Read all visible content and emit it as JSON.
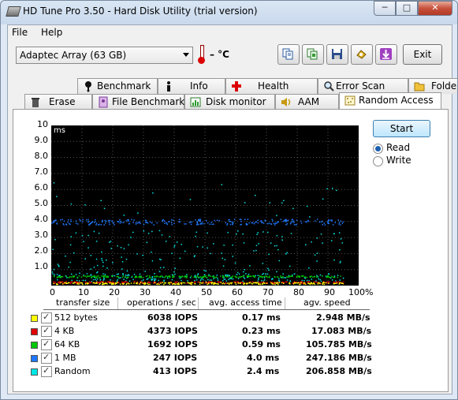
{
  "window": {
    "title": "HD Tune Pro 3.50 - Hard Disk Utility (trial version)"
  },
  "menu": {
    "file": "File",
    "help": "Help"
  },
  "toolbar": {
    "drive": "Adaptec Array (63 GB)",
    "temperature": "– °C",
    "exit": "Exit"
  },
  "tabs_top": [
    {
      "label": "Benchmark",
      "icon": "benchmark-icon"
    },
    {
      "label": "Info",
      "icon": "info-icon"
    },
    {
      "label": "Health",
      "icon": "health-icon"
    },
    {
      "label": "Error Scan",
      "icon": "error-scan-icon"
    },
    {
      "label": "Folder Usage",
      "icon": "folder-icon"
    }
  ],
  "tabs_bottom": [
    {
      "label": "Erase",
      "icon": "erase-icon"
    },
    {
      "label": "File Benchmark",
      "icon": "file-benchmark-icon"
    },
    {
      "label": "Disk monitor",
      "icon": "disk-monitor-icon"
    },
    {
      "label": "AAM",
      "icon": "aam-icon"
    },
    {
      "label": "Random Access",
      "icon": "random-access-icon",
      "active": true
    }
  ],
  "controls": {
    "start": "Start",
    "read": "Read",
    "write": "Write",
    "mode": "Read"
  },
  "table": {
    "headers": [
      "transfer size",
      "operations / sec",
      "avg. access time",
      "agv. speed"
    ],
    "rows": [
      {
        "size": "512 bytes",
        "ops": "6038 IOPS",
        "time": "0.17 ms",
        "speed": "2.948 MB/s",
        "color": "#ffff00",
        "checked": true
      },
      {
        "size": "4 KB",
        "ops": "4373 IOPS",
        "time": "0.23 ms",
        "speed": "17.083 MB/s",
        "color": "#e00000",
        "checked": true
      },
      {
        "size": "64 KB",
        "ops": "1692 IOPS",
        "time": "0.59 ms",
        "speed": "105.785 MB/s",
        "color": "#00c800",
        "checked": true
      },
      {
        "size": "1 MB",
        "ops": "247 IOPS",
        "time": "4.0 ms",
        "speed": "247.186 MB/s",
        "color": "#1e78ff",
        "checked": true
      },
      {
        "size": "Random",
        "ops": "413 IOPS",
        "time": "2.4 ms",
        "speed": "206.858 MB/s",
        "color": "#00e6e6",
        "checked": true
      }
    ]
  },
  "chart_data": {
    "type": "scatter",
    "ylabel": "ms",
    "ylim": [
      0,
      10
    ],
    "xlim": [
      0,
      100
    ],
    "y_ticks": [
      "10",
      "9.0",
      "8.0",
      "7.0",
      "6.0",
      "5.0",
      "4.0",
      "3.0",
      "2.0",
      "1.0"
    ],
    "x_ticks": [
      "0",
      "10",
      "20",
      "30",
      "40",
      "50",
      "60",
      "70",
      "80",
      "90",
      "100%"
    ],
    "grid": true,
    "series": [
      {
        "name": "512 bytes",
        "color": "#ffff00",
        "mean_ms": 0.17,
        "x_range": [
          0,
          95
        ]
      },
      {
        "name": "4 KB",
        "color": "#e00000",
        "mean_ms": 0.23,
        "x_range": [
          0,
          95
        ]
      },
      {
        "name": "64 KB",
        "color": "#00c800",
        "mean_ms": 0.59,
        "x_range": [
          0,
          95
        ]
      },
      {
        "name": "1 MB",
        "color": "#1e78ff",
        "mean_ms": 4.0,
        "x_range": [
          0,
          95
        ]
      },
      {
        "name": "Random",
        "color": "#00e6e6",
        "mean_ms": 2.4,
        "x_range": [
          0,
          95
        ]
      }
    ]
  }
}
